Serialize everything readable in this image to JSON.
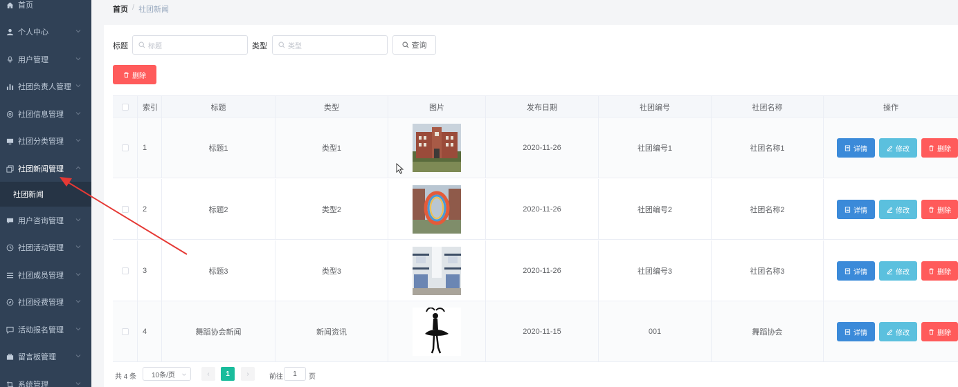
{
  "sidebar": {
    "items": [
      {
        "label": "首页",
        "icon": "home-icon"
      },
      {
        "label": "个人中心",
        "icon": "user-icon"
      },
      {
        "label": "用户管理",
        "icon": "microphone-icon"
      },
      {
        "label": "社团负责人管理",
        "icon": "bar-chart-icon"
      },
      {
        "label": "社团信息管理",
        "icon": "gear-icon"
      },
      {
        "label": "社团分类管理",
        "icon": "monitor-icon"
      },
      {
        "label": "社团新闻管理",
        "icon": "copy-icon"
      },
      {
        "label": "用户咨询管理",
        "icon": "message-icon"
      },
      {
        "label": "社团活动管理",
        "icon": "clock-icon"
      },
      {
        "label": "社团成员管理",
        "icon": "list-icon"
      },
      {
        "label": "社团经费管理",
        "icon": "compass-icon"
      },
      {
        "label": "活动报名管理",
        "icon": "chat-icon"
      },
      {
        "label": "留言板管理",
        "icon": "briefcase-icon"
      },
      {
        "label": "系统管理",
        "icon": "crop-icon"
      }
    ],
    "sub_item": "社团新闻"
  },
  "breadcrumb": {
    "home": "首页",
    "separator": "/",
    "current": "社团新闻"
  },
  "search": {
    "title_label": "标题",
    "title_placeholder": "标题",
    "type_label": "类型",
    "type_placeholder": "类型",
    "query_button": "查询"
  },
  "delete_button": "删除",
  "table": {
    "headers": [
      "索引",
      "标题",
      "类型",
      "图片",
      "发布日期",
      "社团编号",
      "社团名称",
      "操作"
    ],
    "rows": [
      {
        "index": "1",
        "title": "标题1",
        "type": "类型1",
        "image": "campus-building-photo",
        "date": "2020-11-26",
        "club_no": "社团编号1",
        "club_name": "社团名称1"
      },
      {
        "index": "2",
        "title": "标题2",
        "type": "类型2",
        "image": "ring-sculpture-photo",
        "date": "2020-11-26",
        "club_no": "社团编号2",
        "club_name": "社团名称2"
      },
      {
        "index": "3",
        "title": "标题3",
        "type": "类型3",
        "image": "dormitory-photo",
        "date": "2020-11-26",
        "club_no": "社团编号3",
        "club_name": "社团名称3"
      },
      {
        "index": "4",
        "title": "舞蹈协会新闻",
        "type": "新闻资讯",
        "image": "ballet-dancer-silhouette",
        "date": "2020-11-15",
        "club_no": "001",
        "club_name": "舞蹈协会"
      }
    ],
    "actions": {
      "detail": "详情",
      "edit": "修改",
      "delete": "删除"
    }
  },
  "pagination": {
    "total": "共 4 条",
    "page_size": "10条/页",
    "prev": "‹",
    "current_page": "1",
    "next": "›",
    "goto_label": "前往",
    "goto_value": "1",
    "page_unit": "页"
  },
  "colors": {
    "sidebar_bg": "#304156",
    "danger": "#ff5b5b",
    "primary": "#3b8ad9",
    "info": "#5bc0de",
    "pager_active": "#1abc9c",
    "annotation_arrow": "#e53935"
  }
}
